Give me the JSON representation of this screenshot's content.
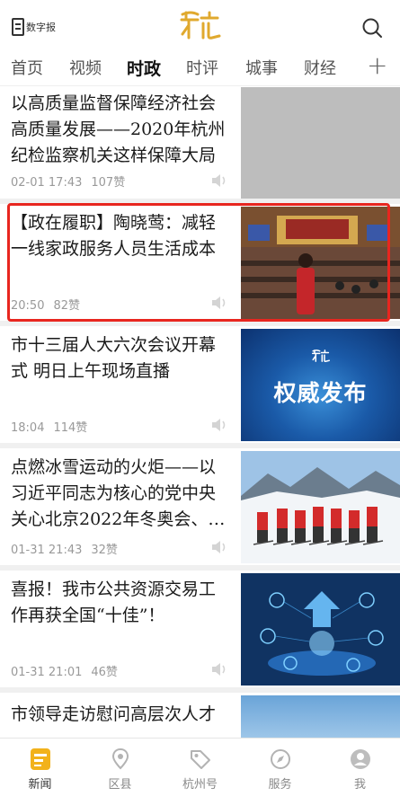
{
  "header": {
    "digital_label": "数字报",
    "logo_text": "杭",
    "accent_color": "#e0a92e"
  },
  "tabs": [
    {
      "label": "首页"
    },
    {
      "label": "视频"
    },
    {
      "label": "时政",
      "active": true
    },
    {
      "label": "时评"
    },
    {
      "label": "城事"
    },
    {
      "label": "财经"
    }
  ],
  "tab_add": "+",
  "articles": [
    {
      "title": "以高质量监督保障经济社会高质量发展——2020年杭州纪检监察机关这样保障大局",
      "time": "02-01 17:43",
      "likes": "107赞"
    },
    {
      "title": "【政在履职】陶晓莺：减轻一线家政服务人员生活成本",
      "time": "20:50",
      "likes": "82赞"
    },
    {
      "title": "市十三届人大六次会议开幕式 明日上午现场直播",
      "time": "18:04",
      "likes": "114赞",
      "thumb_text": "权威发布"
    },
    {
      "title": "点燃冰雪运动的火炬——以习近平同志为核心的党中央关心北京2022年冬奥会、…",
      "time": "01-31 21:43",
      "likes": "32赞"
    },
    {
      "title": "喜报！我市公共资源交易工作再获全国“十佳”！",
      "time": "01-31 21:01",
      "likes": "46赞"
    },
    {
      "title": "市领导走访慰问高层次人才",
      "time": "",
      "likes": ""
    }
  ],
  "bottom_nav": [
    {
      "label": "新闻",
      "active": true
    },
    {
      "label": "区县"
    },
    {
      "label": "杭州号"
    },
    {
      "label": "服务"
    },
    {
      "label": "我"
    }
  ]
}
